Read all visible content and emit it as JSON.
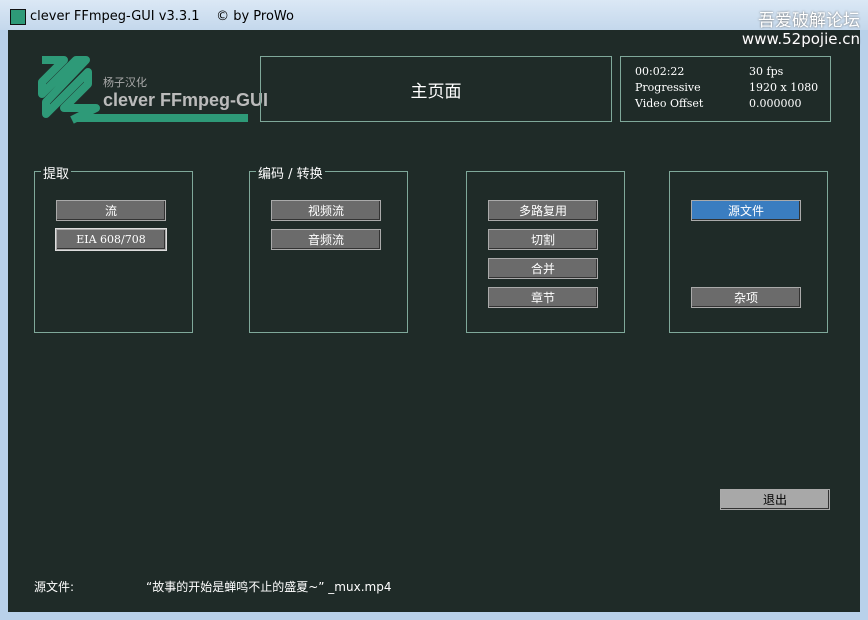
{
  "window": {
    "title": "clever FFmpeg-GUI v3.3.1    © by ProWo"
  },
  "watermark": {
    "line1": "吾爱破解论坛",
    "line2": "www.52pojie.cn"
  },
  "logo": {
    "subtitle": "杨子汉化",
    "text": "clever FFmpeg-GUI",
    "color": "#2e9a78"
  },
  "page_title": "主页面",
  "info": {
    "duration": "00:02:22",
    "fps": "30 fps",
    "scan": "Progressive",
    "resolution": "1920 x 1080",
    "offset_label": "Video Offset",
    "offset_value": "0.000000"
  },
  "groups": {
    "extract": {
      "label": "提取",
      "buttons": [
        "流",
        "EIA 608/708"
      ]
    },
    "encode": {
      "label": "编码 / 转换",
      "buttons": [
        "视频流",
        "音频流"
      ]
    },
    "mux": {
      "buttons": [
        "多路复用",
        "切割",
        "合并",
        "章节"
      ]
    },
    "misc": {
      "buttons": [
        "源文件",
        "杂项"
      ]
    }
  },
  "exit_label": "退出",
  "source": {
    "label": "源文件:",
    "value": "“故事的开始是蝉鸣不止的盛夏~” _mux.mp4"
  }
}
